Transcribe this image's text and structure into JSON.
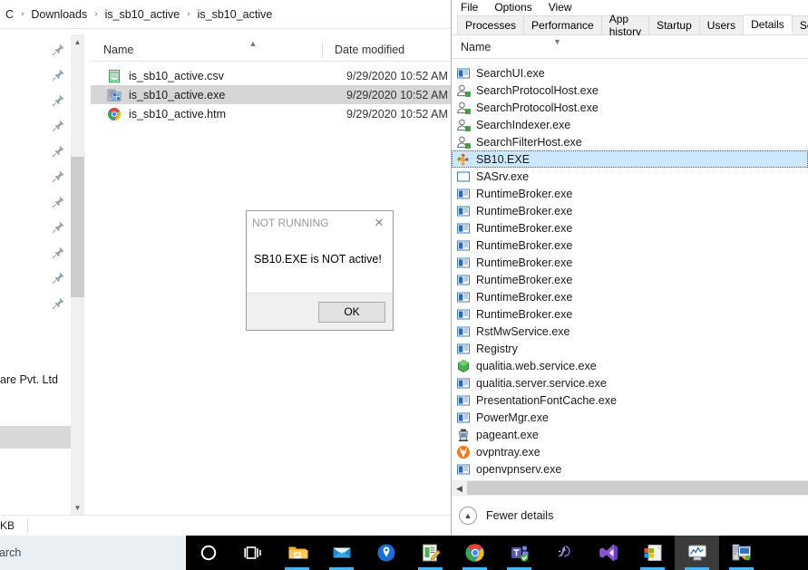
{
  "explorer": {
    "breadcrumb": {
      "name": "address-breadcrumb",
      "items": [
        "C",
        "Downloads",
        "is_sb10_active",
        "is_sb10_active"
      ],
      "separator": "›"
    },
    "columns": {
      "name": "Name",
      "date_modified": "Date modified"
    },
    "files": [
      {
        "name": "is_sb10_active.csv",
        "date": "9/29/2020 10:52 AM",
        "icon": "csv-file-icon",
        "selected": false
      },
      {
        "name": "is_sb10_active.exe",
        "date": "9/29/2020 10:52 AM",
        "icon": "exe-installer-icon",
        "selected": true
      },
      {
        "name": "is_sb10_active.htm",
        "date": "9/29/2020 10:52 AM",
        "icon": "chrome-html-icon",
        "selected": false
      }
    ],
    "nav_partial_text": "are Pvt. Ltd",
    "status_size": "KB",
    "pin_count": 11,
    "pin_icon": "pin-icon",
    "sort_caret_icon": "sort-ascending-caret-icon"
  },
  "dialog": {
    "title": "NOT RUNNING",
    "close_icon": "close-icon",
    "message": "SB10.EXE is NOT active!",
    "ok_label": "OK"
  },
  "taskmanager": {
    "menus": [
      "File",
      "Options",
      "View"
    ],
    "tabs": [
      {
        "label": "Processes",
        "active": false
      },
      {
        "label": "Performance",
        "active": false
      },
      {
        "label": "App history",
        "active": false
      },
      {
        "label": "Startup",
        "active": false
      },
      {
        "label": "Users",
        "active": false
      },
      {
        "label": "Details",
        "active": true
      },
      {
        "label": "Servic",
        "active": false
      }
    ],
    "column_header": "Name",
    "sort_caret_icon": "sort-descending-caret-icon",
    "processes": [
      {
        "name": "SearchUI.exe",
        "icon": "window-app-icon",
        "selected": false
      },
      {
        "name": "SearchProtocolHost.exe",
        "icon": "service-user-icon",
        "selected": false
      },
      {
        "name": "SearchProtocolHost.exe",
        "icon": "service-user-icon",
        "selected": false
      },
      {
        "name": "SearchIndexer.exe",
        "icon": "service-user-icon",
        "selected": false
      },
      {
        "name": "SearchFilterHost.exe",
        "icon": "service-user-icon",
        "selected": false
      },
      {
        "name": "SB10.EXE",
        "icon": "sb10-puzzle-icon",
        "selected": true
      },
      {
        "name": "SASrv.exe",
        "icon": "blank-window-icon",
        "selected": false
      },
      {
        "name": "RuntimeBroker.exe",
        "icon": "window-app-icon",
        "selected": false
      },
      {
        "name": "RuntimeBroker.exe",
        "icon": "window-app-icon",
        "selected": false
      },
      {
        "name": "RuntimeBroker.exe",
        "icon": "window-app-icon",
        "selected": false
      },
      {
        "name": "RuntimeBroker.exe",
        "icon": "window-app-icon",
        "selected": false
      },
      {
        "name": "RuntimeBroker.exe",
        "icon": "window-app-icon",
        "selected": false
      },
      {
        "name": "RuntimeBroker.exe",
        "icon": "window-app-icon",
        "selected": false
      },
      {
        "name": "RuntimeBroker.exe",
        "icon": "window-app-icon",
        "selected": false
      },
      {
        "name": "RuntimeBroker.exe",
        "icon": "window-app-icon",
        "selected": false
      },
      {
        "name": "RstMwService.exe",
        "icon": "window-app-icon",
        "selected": false
      },
      {
        "name": "Registry",
        "icon": "window-app-icon",
        "selected": false
      },
      {
        "name": "qualitia.web.service.exe",
        "icon": "green-hex-icon",
        "selected": false
      },
      {
        "name": "qualitia.server.service.exe",
        "icon": "window-app-icon",
        "selected": false
      },
      {
        "name": "PresentationFontCache.exe",
        "icon": "window-app-icon",
        "selected": false
      },
      {
        "name": "PowerMgr.exe",
        "icon": "window-app-icon",
        "selected": false
      },
      {
        "name": "pageant.exe",
        "icon": "pageant-icon",
        "selected": false
      },
      {
        "name": "ovpntray.exe",
        "icon": "openvpn-icon",
        "selected": false
      },
      {
        "name": "openvpnserv.exe",
        "icon": "window-app-icon",
        "selected": false
      }
    ],
    "hscroll_left_icon": "scroll-left-icon",
    "footer": {
      "label": "Fewer details",
      "icon": "chevron-up-circle-icon"
    }
  },
  "taskbar": {
    "search_placeholder": "earch",
    "items": [
      {
        "name": "cortana-icon",
        "active": false,
        "running": false
      },
      {
        "name": "task-view-icon",
        "active": false,
        "running": false
      },
      {
        "name": "file-explorer-icon",
        "active": false,
        "running": true
      },
      {
        "name": "mail-icon",
        "active": false,
        "running": true
      },
      {
        "name": "maps-icon",
        "active": false,
        "running": false
      },
      {
        "name": "notepad-editor-icon",
        "active": false,
        "running": true
      },
      {
        "name": "chrome-icon",
        "active": false,
        "running": true
      },
      {
        "name": "microsoft-teams-icon",
        "active": false,
        "running": true
      },
      {
        "name": "sql-server-profiler-icon",
        "active": false,
        "running": false
      },
      {
        "name": "visual-studio-icon",
        "active": false,
        "running": false
      },
      {
        "name": "windows-media-icon",
        "active": false,
        "running": true
      },
      {
        "name": "task-manager-icon",
        "active": true,
        "running": true
      },
      {
        "name": "sb10-app-icon",
        "active": false,
        "running": true
      }
    ]
  },
  "colors": {
    "selection_blue": "#cce8ff",
    "explorer_selection_gray": "#d6d6d6",
    "taskbar_black": "#000000",
    "taskbar_accent": "#4cb4ec",
    "search_bg": "#eceff2"
  }
}
